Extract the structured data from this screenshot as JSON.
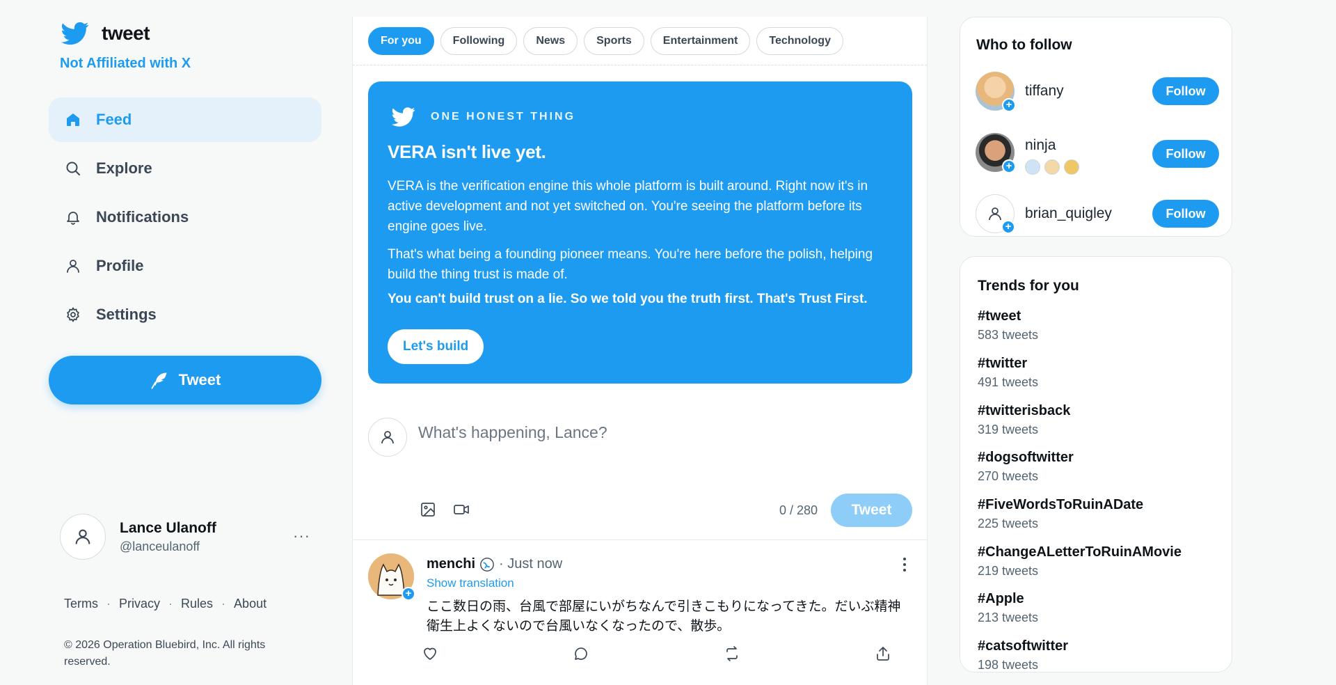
{
  "brand": {
    "name": "tweet",
    "tagline": "Not Affiliated with X",
    "accent": "#1d9bf0"
  },
  "nav": [
    {
      "label": "Feed",
      "icon": "home-icon",
      "active": true
    },
    {
      "label": "Explore",
      "icon": "search-icon"
    },
    {
      "label": "Notifications",
      "icon": "bell-icon"
    },
    {
      "label": "Profile",
      "icon": "user-icon"
    },
    {
      "label": "Settings",
      "icon": "gear-icon"
    }
  ],
  "tweet_button": "Tweet",
  "account": {
    "name": "Lance Ulanoff",
    "handle": "@lanceulanoff",
    "more": "···"
  },
  "footer": {
    "links": [
      "Terms",
      "Privacy",
      "Rules",
      "About"
    ],
    "separator": "·",
    "copyright": "© 2026 Operation Bluebird, Inc. All rights reserved."
  },
  "tabs": [
    "For you",
    "Following",
    "News",
    "Sports",
    "Entertainment",
    "Technology"
  ],
  "banner": {
    "kicker": "ONE HONEST THING",
    "title": "VERA isn't live yet.",
    "p1": "VERA is the verification engine this whole platform is built around. Right now it's in active development and not yet switched on. You're seeing the platform before its engine goes live.",
    "p2": "That's what being a founding pioneer means. You're here before the polish, helping build the thing trust is made of.",
    "p3": "You can't build trust on a lie. So we told you the truth first. That's Trust First.",
    "button": "Let's build"
  },
  "composer": {
    "placeholder": "What's happening, Lance?",
    "count": "0 / 280",
    "button": "Tweet"
  },
  "post": {
    "author": "menchi",
    "time": "· Just now",
    "show_translation": "Show translation",
    "text": "ここ数日の雨、台風で部屋にいがちなんで引きこもりになってきた。だいぶ精神衛生上よくないので台風いなくなったので、散歩。"
  },
  "who_to_follow": {
    "title": "Who to follow",
    "follow_label": "Follow",
    "users": [
      "tiffany",
      "ninja",
      "brian_quigley"
    ]
  },
  "trends": {
    "title": "Trends for you",
    "items": [
      {
        "tag": "#tweet",
        "count": "583 tweets"
      },
      {
        "tag": "#twitter",
        "count": "491 tweets"
      },
      {
        "tag": "#twitterisback",
        "count": "319 tweets"
      },
      {
        "tag": "#dogsoftwitter",
        "count": "270 tweets"
      },
      {
        "tag": "#FiveWordsToRuinADate",
        "count": "225 tweets"
      },
      {
        "tag": "#ChangeALetterToRuinAMovie",
        "count": "219 tweets"
      },
      {
        "tag": "#Apple",
        "count": "213 tweets"
      },
      {
        "tag": "#catsoftwitter",
        "count": "198 tweets"
      }
    ]
  }
}
